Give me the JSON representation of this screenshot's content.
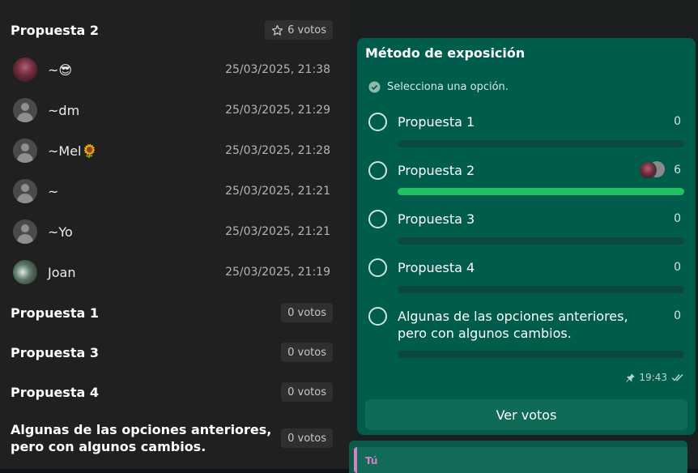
{
  "left_panel": {
    "sections": [
      {
        "title": "Propuesta 2",
        "votes_label": "6 votos",
        "star": true,
        "voters": [
          {
            "name": "~😎",
            "time": "25/03/2025, 21:38",
            "avatar": "photo"
          },
          {
            "name": "~dm",
            "time": "25/03/2025, 21:29",
            "avatar": "default"
          },
          {
            "name": "~Mel🌻",
            "time": "25/03/2025, 21:28",
            "avatar": "default"
          },
          {
            "name": "~",
            "time": "25/03/2025, 21:21",
            "avatar": "default"
          },
          {
            "name": "~Yo",
            "time": "25/03/2025, 21:21",
            "avatar": "default"
          },
          {
            "name": "Joan",
            "time": "25/03/2025, 21:19",
            "avatar": "photo"
          }
        ]
      },
      {
        "title": "Propuesta 1",
        "votes_label": "0 votos"
      },
      {
        "title": "Propuesta 3",
        "votes_label": "0 votos"
      },
      {
        "title": "Propuesta 4",
        "votes_label": "0 votos"
      },
      {
        "title": "Algunas de las opciones anteriores, pero con algunos cambios.",
        "votes_label": "0 votos"
      }
    ]
  },
  "poll": {
    "question": "Método de exposición",
    "hint": "Selecciona una opción.",
    "options": [
      {
        "label": "Propuesta 1",
        "count": "0",
        "share": 0
      },
      {
        "label": "Propuesta 2",
        "count": "6",
        "share": 1
      },
      {
        "label": "Propuesta 3",
        "count": "0",
        "share": 0
      },
      {
        "label": "Propuesta 4",
        "count": "0",
        "share": 0
      },
      {
        "label": "Algunas de las opciones anteriores, pero con algunos cambios.",
        "count": "0",
        "share": 0
      }
    ],
    "time": "19:43",
    "pinned_icon": "pin-icon",
    "status_icon": "double-check-icon",
    "view_votes_label": "Ver votos"
  },
  "reply": {
    "author": "Tú"
  },
  "colors": {
    "panel_bg": "#202020",
    "poll_bg": "#005c4b",
    "bar_fill": "#21c063",
    "reply_accent": "#d67fc4"
  }
}
